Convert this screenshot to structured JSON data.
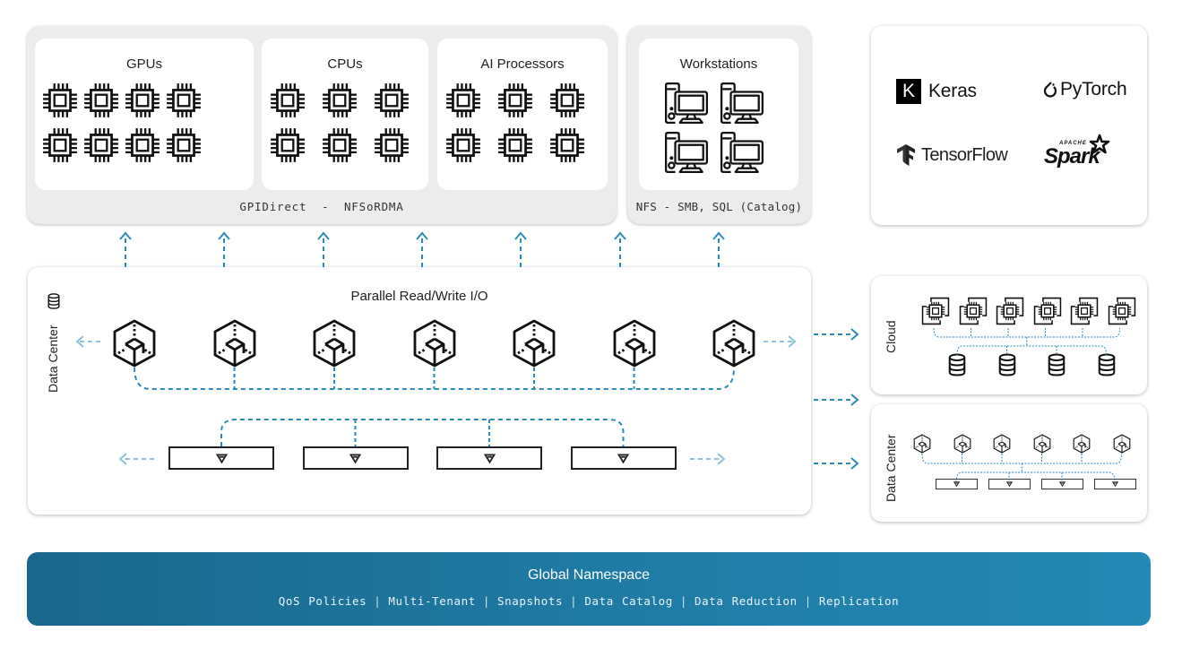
{
  "compute": {
    "groups": [
      {
        "title": "GPUs",
        "icon": "chip-icon",
        "count": 8
      },
      {
        "title": "CPUs",
        "icon": "chip-icon",
        "count": 6
      },
      {
        "title": "AI Processors",
        "icon": "chip-icon",
        "count": 6
      }
    ],
    "protocol_label": "GPIDirect  -  NFSoRDMA"
  },
  "workstations": {
    "title": "Workstations",
    "icon": "workstation-icon",
    "count": 4,
    "protocol_label": "NFS - SMB, SQL (Catalog)"
  },
  "frameworks": {
    "items": [
      {
        "name": "Keras",
        "icon": "keras-logo",
        "badge": "K"
      },
      {
        "name": "PyTorch",
        "icon": "pytorch-logo"
      },
      {
        "name": "TensorFlow",
        "icon": "tensorflow-logo"
      },
      {
        "name": "Spark",
        "icon": "spark-logo",
        "prefix": "APACHE"
      }
    ]
  },
  "storage": {
    "title": "Parallel Read/Write I/O",
    "side_label": "Data Center",
    "side_icon": "database-icon",
    "server_nodes": 7,
    "server_icon": "server-cube-icon",
    "drive_count": 4,
    "drive_icon": "triangle-down-icon"
  },
  "cloud": {
    "label": "Cloud",
    "compute_nodes": 6,
    "compute_icon": "cloud-chip-icon",
    "storage_nodes": 4,
    "storage_icon": "database-icon"
  },
  "remote_datacenter": {
    "label": "Data Center",
    "server_nodes": 6,
    "drive_count": 4
  },
  "banner": {
    "title": "Global Namespace",
    "features": [
      "QoS Policies",
      "Multi-Tenant",
      "Snapshots",
      "Data Catalog",
      "Data Reduction",
      "Replication"
    ]
  },
  "colors": {
    "connector": "#2a8ab8",
    "connector_light": "#8cc4de",
    "banner_start": "#1a678c",
    "banner_end": "#2489b5",
    "panel_gray": "#ececec"
  }
}
